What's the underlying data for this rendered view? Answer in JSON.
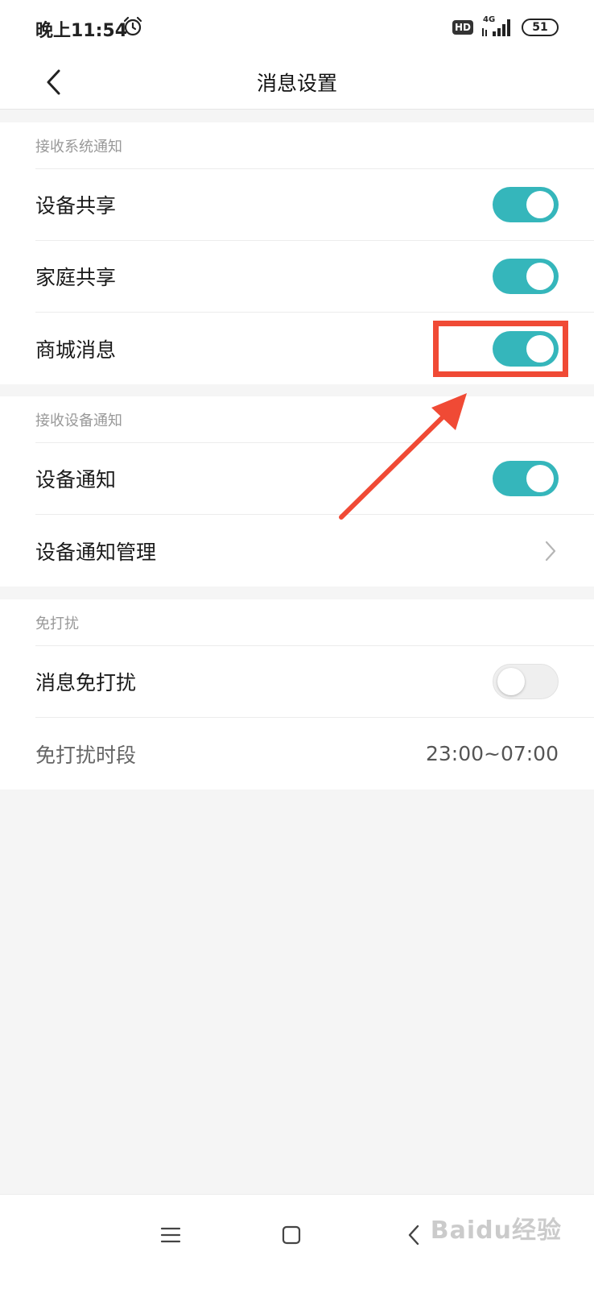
{
  "status_bar": {
    "time": "晚上11:54",
    "hd": "HD",
    "network": "4G",
    "battery": "51"
  },
  "header": {
    "title": "消息设置"
  },
  "sections": [
    {
      "header": "接收系统通知",
      "rows": [
        {
          "label": "设备共享",
          "toggle": "on"
        },
        {
          "label": "家庭共享",
          "toggle": "on"
        },
        {
          "label": "商城消息",
          "toggle": "on"
        }
      ]
    },
    {
      "header": "接收设备通知",
      "rows": [
        {
          "label": "设备通知",
          "toggle": "on"
        },
        {
          "label": "设备通知管理",
          "control": "chevron-right-icon"
        }
      ]
    },
    {
      "header": "免打扰",
      "rows": [
        {
          "label": "消息免打扰",
          "toggle": "off"
        },
        {
          "label": "免打扰时段",
          "value": "23:00~07:00"
        }
      ]
    }
  ],
  "colors": {
    "toggle_on": "#35b6bb",
    "annotation": "#f04a35"
  },
  "watermark": "Baidu经验"
}
